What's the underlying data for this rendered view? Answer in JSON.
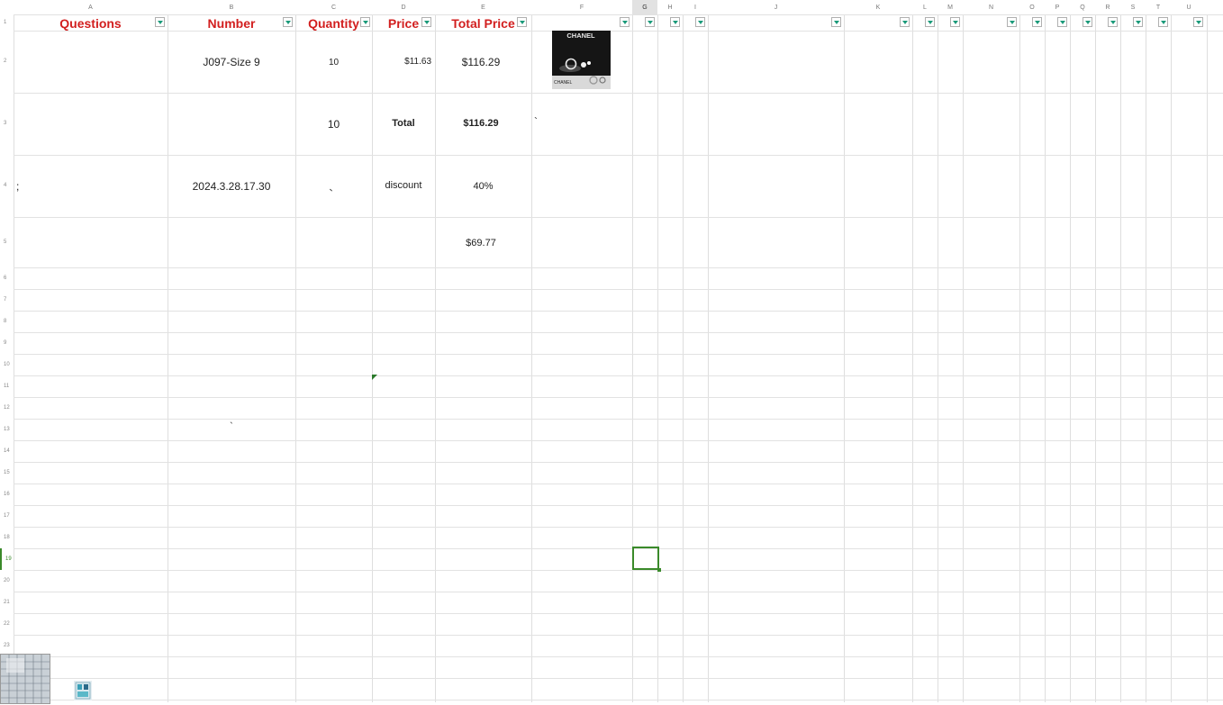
{
  "columns": [
    "A",
    "B",
    "C",
    "D",
    "E",
    "F",
    "G",
    "H",
    "I",
    "J",
    "K",
    "L",
    "M",
    "N",
    "O",
    "P",
    "Q",
    "R",
    "S",
    "T",
    "U"
  ],
  "rows": [
    "1",
    "2",
    "3",
    "4",
    "5",
    "6",
    "7",
    "8",
    "9",
    "10",
    "11",
    "12",
    "13",
    "14",
    "15",
    "16",
    "17",
    "18",
    "19",
    "20",
    "21",
    "22",
    "23"
  ],
  "headers": {
    "questions": "Questions",
    "number": "Number",
    "quantity": "Quantity",
    "price": "Price",
    "total_price": "Total Price"
  },
  "cells": {
    "b2": "J097-Size 9",
    "c2": "10",
    "d2": "$11.63",
    "e2": "$116.29",
    "c3": "10",
    "d3": "Total",
    "e3": "$116.29",
    "f3": "`",
    "a4": ";",
    "b4": "2024.3.28.17.30",
    "c4": "、",
    "d4": "discount",
    "e4": "40%",
    "e5": "$69.77",
    "b13": "`"
  },
  "image": {
    "brand_top": "CHANEL",
    "brand_bottom": "CHANEL",
    "icon": "product-photo"
  },
  "colors": {
    "header_text": "#d21f1f",
    "filter_arrow": "#1a9a7a",
    "selection": "#3a8a2a"
  }
}
